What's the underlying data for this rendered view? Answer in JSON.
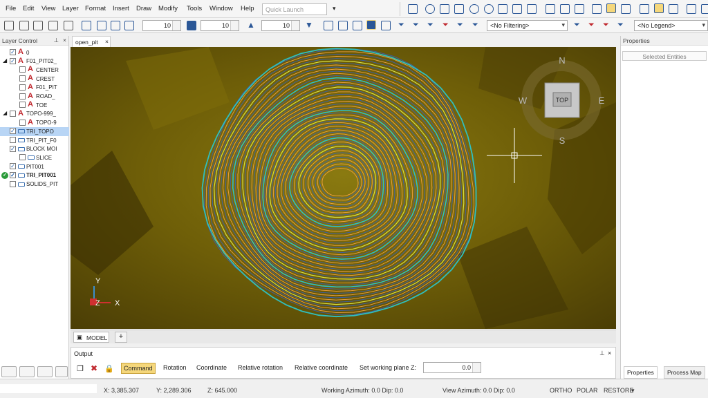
{
  "menu": [
    "File",
    "Edit",
    "View",
    "Layer",
    "Format",
    "Insert",
    "Draw",
    "Modify",
    "Tools",
    "Window",
    "Help"
  ],
  "quick_launch": {
    "placeholder": "Quick Launch"
  },
  "toolbar": {
    "spin1": "10",
    "spin2": "10",
    "spin3": "10",
    "filter": "<No Filtering>",
    "legend": "<No Legend>"
  },
  "layer_control": {
    "title": "Layer Control",
    "items": [
      {
        "label": "0",
        "checked": true,
        "type": "layer",
        "indent": 1
      },
      {
        "label": "F01_PIT02_",
        "checked": true,
        "type": "group",
        "indent": 1
      },
      {
        "label": "CENTER",
        "checked": false,
        "type": "layer",
        "indent": 2
      },
      {
        "label": "CREST",
        "checked": false,
        "type": "layer",
        "indent": 2
      },
      {
        "label": "F01_PIT",
        "checked": false,
        "type": "layer",
        "indent": 2
      },
      {
        "label": "ROAD_",
        "checked": false,
        "type": "layer",
        "indent": 2
      },
      {
        "label": "TOE",
        "checked": false,
        "type": "layer",
        "indent": 2
      },
      {
        "label": "TOPO-999_",
        "checked": false,
        "type": "group",
        "indent": 1
      },
      {
        "label": "TOPO-9",
        "checked": false,
        "type": "layer",
        "indent": 2
      },
      {
        "label": "TRI_TOPO",
        "checked": true,
        "type": "tri",
        "indent": 1,
        "selected": true
      },
      {
        "label": "TRI_PIT_F0",
        "checked": false,
        "type": "tri",
        "indent": 1
      },
      {
        "label": "BLOCK MOI",
        "checked": true,
        "type": "tri",
        "indent": 1
      },
      {
        "label": "SLICE",
        "checked": false,
        "type": "tri",
        "indent": 2
      },
      {
        "label": "PIT001",
        "checked": true,
        "type": "tri",
        "indent": 1
      },
      {
        "label": "TRI_PIT001",
        "checked": true,
        "type": "tri",
        "indent": 1,
        "bold": true,
        "active": true
      },
      {
        "label": "SOLIDS_PIT",
        "checked": false,
        "type": "tri",
        "indent": 1
      }
    ]
  },
  "document_tab": "open_pit",
  "model_tab": "MODEL",
  "viewcube": {
    "top": "TOP",
    "n": "N",
    "s": "S",
    "e": "E",
    "w": "W"
  },
  "axes": {
    "x": "X",
    "y": "Y",
    "z": "Z"
  },
  "output": {
    "title": "Output",
    "buttons": [
      "Command",
      "Rotation",
      "Coordinate",
      "Relative rotation",
      "Relative coordinate",
      "Set working plane Z:"
    ],
    "plane_z": "0.0"
  },
  "properties": {
    "title": "Properties",
    "selected": "Selected Entities",
    "tabs": [
      "Properties",
      "Process Map"
    ]
  },
  "status": {
    "x": "X: 3,385.307",
    "y": "Y: 2,289.306",
    "z": "Z: 645.000",
    "working": "Working Azimuth: 0.0 Dip: 0.0",
    "view": "View Azimuth: 0.0 Dip: 0.0",
    "ortho": "ORTHO",
    "polar": "POLAR",
    "restore": "RESTORE"
  },
  "colors": {
    "terrain": "#6b5a06",
    "contour_orange": "#f0a040",
    "contour_blue": "#3a5fb0",
    "contour_cyan": "#2fbfc0",
    "contour_yellow": "#d8e040"
  }
}
